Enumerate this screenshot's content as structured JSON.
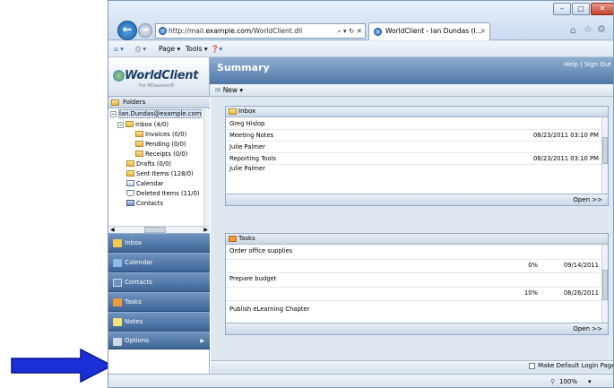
{
  "browser": {
    "address_prefix": "http://mail.",
    "address_domain": "example.com",
    "address_rest": "/WorldClient.dll",
    "address_controls": "⌕ ▾ ↻ ✕",
    "tab_title": "WorldClient - Ian Dundas (I...",
    "tab_close": "✕",
    "command_bar": [
      "Page ▾",
      "Tools ▾"
    ],
    "window_buttons": [
      "–",
      "□",
      "✕"
    ]
  },
  "app": {
    "logo_text": "WorldClient",
    "logo_sub": "For MDaemon®",
    "header_title": "Summary",
    "header_links": "Help | Sign Out",
    "new_button": "New ▾"
  },
  "sidebar": {
    "folders_header": "Folders",
    "tree": [
      {
        "label": "Ian.Dundas@example.com",
        "level": 0,
        "expander": "−",
        "icon": "account-icon"
      },
      {
        "label": "Inbox (4/0)",
        "level": 1,
        "expander": "−",
        "icon": "folder-icon"
      },
      {
        "label": "Invoices (0/0)",
        "level": 2,
        "icon": "folder-icon"
      },
      {
        "label": "Pending (0/0)",
        "level": 2,
        "icon": "folder-icon"
      },
      {
        "label": "Receipts (0/0)",
        "level": 2,
        "icon": "folder-icon"
      },
      {
        "label": "Drafts (0/0)",
        "level": 1,
        "icon": "folder-icon"
      },
      {
        "label": "Sent Items (128/0)",
        "level": 1,
        "icon": "folder-icon"
      },
      {
        "label": "Calendar",
        "level": 1,
        "icon": "calendar-icon"
      },
      {
        "label": "Deleted Items (11/0)",
        "level": 1,
        "icon": "trash-icon"
      },
      {
        "label": "Contacts",
        "level": 1,
        "icon": "contacts-icon"
      }
    ],
    "nav": [
      {
        "label": "Inbox",
        "icon": "inbox-icon",
        "color": "#f2c94c"
      },
      {
        "label": "Calendar",
        "icon": "calendar-icon",
        "color": "#8fbbe8"
      },
      {
        "label": "Contacts",
        "icon": "contacts-icon",
        "color": "#6e8fbf"
      },
      {
        "label": "Tasks",
        "icon": "tasks-icon",
        "color": "#f29b3a"
      },
      {
        "label": "Notes",
        "icon": "notes-icon",
        "color": "#f7e27a"
      },
      {
        "label": "Options",
        "icon": "options-icon",
        "color": "#cfd8e3",
        "arrow": "▶"
      }
    ]
  },
  "inbox_panel": {
    "title": "Inbox",
    "rows": [
      {
        "from": "Greg Hislop",
        "subject": "Meeting Notes",
        "date": "08/23/2011 03:10 PM"
      },
      {
        "from": "Julie Palmer",
        "subject": "Reporting Tools",
        "date": "08/23/2011 03:10 PM"
      },
      {
        "from": "Julie Palmer",
        "subject": "",
        "date": ""
      }
    ],
    "open_link": "Open >>"
  },
  "tasks_panel": {
    "title": "Tasks",
    "rows": [
      {
        "name": "Order office supplies",
        "percent": "0%",
        "due": "09/14/2011"
      },
      {
        "name": "Prepare budget",
        "percent": "10%",
        "due": "08/26/2011"
      },
      {
        "name": "Publish eLearning Chapter",
        "percent": "",
        "due": ""
      }
    ],
    "open_link": "Open >>"
  },
  "bottom": {
    "make_default": "Make Default Login Page"
  },
  "status": {
    "zoom": "100%",
    "zoom_arrow": "▾"
  },
  "colors": {
    "pointer_arrow": "#1a2fd6"
  }
}
